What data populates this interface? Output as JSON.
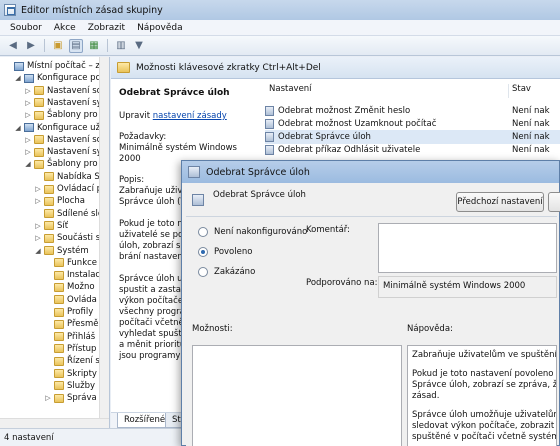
{
  "window": {
    "title": "Editor místních zásad skupiny",
    "menu": [
      "Soubor",
      "Akce",
      "Zobrazit",
      "Nápověda"
    ],
    "status": "4 nastavení"
  },
  "tree": {
    "items": [
      {
        "label": "Místní počítač – zásac",
        "icon": "computer-icon",
        "expander": "",
        "indent": 0
      },
      {
        "label": "Konfigurace počít",
        "icon": "computer-icon",
        "expander": "◢",
        "indent": 1
      },
      {
        "label": "Nastavení softw",
        "icon": "folder-icon",
        "expander": "▷",
        "indent": 2
      },
      {
        "label": "Nastavení syst",
        "icon": "folder-icon",
        "expander": "▷",
        "indent": 2
      },
      {
        "label": "Šablony pro sp",
        "icon": "folder-icon",
        "expander": "▷",
        "indent": 2
      },
      {
        "label": "Konfigurace uživate",
        "icon": "computer-icon",
        "expander": "◢",
        "indent": 1
      },
      {
        "label": "Nastavení soft",
        "icon": "folder-icon",
        "expander": "▷",
        "indent": 2
      },
      {
        "label": "Nastavení syst",
        "icon": "folder-icon",
        "expander": "▷",
        "indent": 2
      },
      {
        "label": "Šablony pro sp",
        "icon": "folder-icon",
        "expander": "◢",
        "indent": 2
      },
      {
        "label": "Nabídka St",
        "icon": "folder-icon",
        "expander": "",
        "indent": 3
      },
      {
        "label": "Ovládací p",
        "icon": "folder-icon",
        "expander": "▷",
        "indent": 3
      },
      {
        "label": "Plocha",
        "icon": "folder-icon",
        "expander": "▷",
        "indent": 3
      },
      {
        "label": "Sdílené slo",
        "icon": "folder-icon",
        "expander": "",
        "indent": 3
      },
      {
        "label": "Síť",
        "icon": "folder-icon",
        "expander": "▷",
        "indent": 3
      },
      {
        "label": "Součásti sy",
        "icon": "folder-icon",
        "expander": "▷",
        "indent": 3
      },
      {
        "label": "Systém",
        "icon": "folder-icon",
        "expander": "◢",
        "indent": 3
      },
      {
        "label": "Funkce",
        "icon": "folder-icon",
        "expander": "",
        "indent": 4
      },
      {
        "label": "Instalac",
        "icon": "folder-icon",
        "expander": "",
        "indent": 4
      },
      {
        "label": "Možno",
        "icon": "folder-icon",
        "expander": "",
        "indent": 4
      },
      {
        "label": "Ovláda",
        "icon": "folder-icon",
        "expander": "",
        "indent": 4
      },
      {
        "label": "Profily",
        "icon": "folder-icon",
        "expander": "",
        "indent": 4
      },
      {
        "label": "Přesmě",
        "icon": "folder-icon",
        "expander": "",
        "indent": 4
      },
      {
        "label": "Přihláš",
        "icon": "folder-icon",
        "expander": "",
        "indent": 4
      },
      {
        "label": "Přístup",
        "icon": "folder-icon",
        "expander": "",
        "indent": 4
      },
      {
        "label": "Řízení s",
        "icon": "folder-icon",
        "expander": "",
        "indent": 4
      },
      {
        "label": "Skripty",
        "icon": "folder-icon",
        "expander": "",
        "indent": 4
      },
      {
        "label": "Služby",
        "icon": "folder-icon",
        "expander": "",
        "indent": 4
      },
      {
        "label": "Správa",
        "icon": "folder-icon",
        "expander": "▷",
        "indent": 4
      }
    ]
  },
  "right": {
    "folder_title": "Možnosti klávesové zkratky Ctrl+Alt+Del",
    "detail": {
      "heading": "Odebrat Správce úloh",
      "edit_prefix": "Upravit",
      "edit_link": "nastavení zásady",
      "req_label": "Požadavky:",
      "req_value": "Minimálně systém Windows 2000",
      "desc_label": "Popis:",
      "desc_lines": [
        "Zabraňuje uživatel",
        "Správce úloh (Ta",
        "",
        "Pokud je toto nast",
        "uživatelé se poku",
        "úloh, zobrazí se z",
        "brání nastavení z",
        "",
        "Správce úloh um",
        "spustit a zastavit",
        "výkon počítače, z",
        "všechny program",
        "počítači včetně s",
        "vyhledat spuště",
        "a měnit prioritu p",
        "jsou programy sp"
      ]
    },
    "list": {
      "col_setting": "Nastavení",
      "col_state": "Stav",
      "rows": [
        {
          "name": "Odebrat možnost Změnit heslo",
          "state": "Není nak"
        },
        {
          "name": "Odebrat možnost Uzamknout počítač",
          "state": "Není nak"
        },
        {
          "name": "Odebrat Správce úloh",
          "state": "Není nak"
        },
        {
          "name": "Odebrat příkaz Odhlásit uživatele",
          "state": "Není nak"
        }
      ]
    },
    "tabs": [
      "Rozšířené",
      "Sta"
    ]
  },
  "dialog": {
    "title": "Odebrat Správce úloh",
    "policy_name": "Odebrat Správce úloh",
    "prev_button": "Předchozí nastavení",
    "options": [
      {
        "label": "Není nakonfigurováno",
        "checked": false
      },
      {
        "label": "Povoleno",
        "checked": true
      },
      {
        "label": "Zakázáno",
        "checked": false
      }
    ],
    "comment_label": "Komentář:",
    "supported_label": "Podporováno na:",
    "supported_value": "Minimálně systém Windows 2000",
    "options_label": "Možnosti:",
    "help_label": "Nápověda:",
    "help_lines": [
      "Zabraňuje uživatelům ve spuštění Správ",
      "Pokud je toto nastavení povoleno a uživ",
      "Správce úloh, zobrazí se zpráva, že dané",
      "zásad.",
      "Správce úloh umožňuje uživatelům spus",
      "sledovat výkon počítače, zobrazit a sledo",
      "spuštěné v počítači včetně systémových"
    ]
  }
}
